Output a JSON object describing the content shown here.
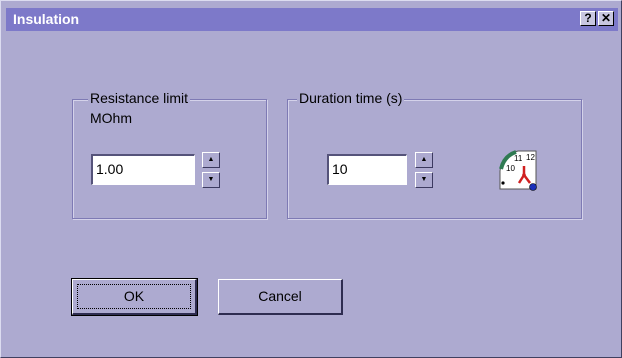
{
  "window": {
    "title": "Insulation",
    "help_button_label": "?",
    "close_button_label": "✕"
  },
  "resistance": {
    "group_label": "Resistance limit",
    "unit_label": "MOhm",
    "value": "1.00",
    "spin_up": "▲",
    "spin_down": "▼"
  },
  "duration": {
    "group_label": "Duration time (s)",
    "value": "10",
    "spin_up": "▲",
    "spin_down": "▼",
    "icon": "stopwatch-icon",
    "icon_labels": [
      "11",
      "12",
      "10"
    ]
  },
  "buttons": {
    "ok_label": "OK",
    "cancel_label": "Cancel"
  },
  "colors": {
    "dialog_background": "#adaad0",
    "titlebar": "#7d79c9",
    "title_text": "#ffffff"
  }
}
